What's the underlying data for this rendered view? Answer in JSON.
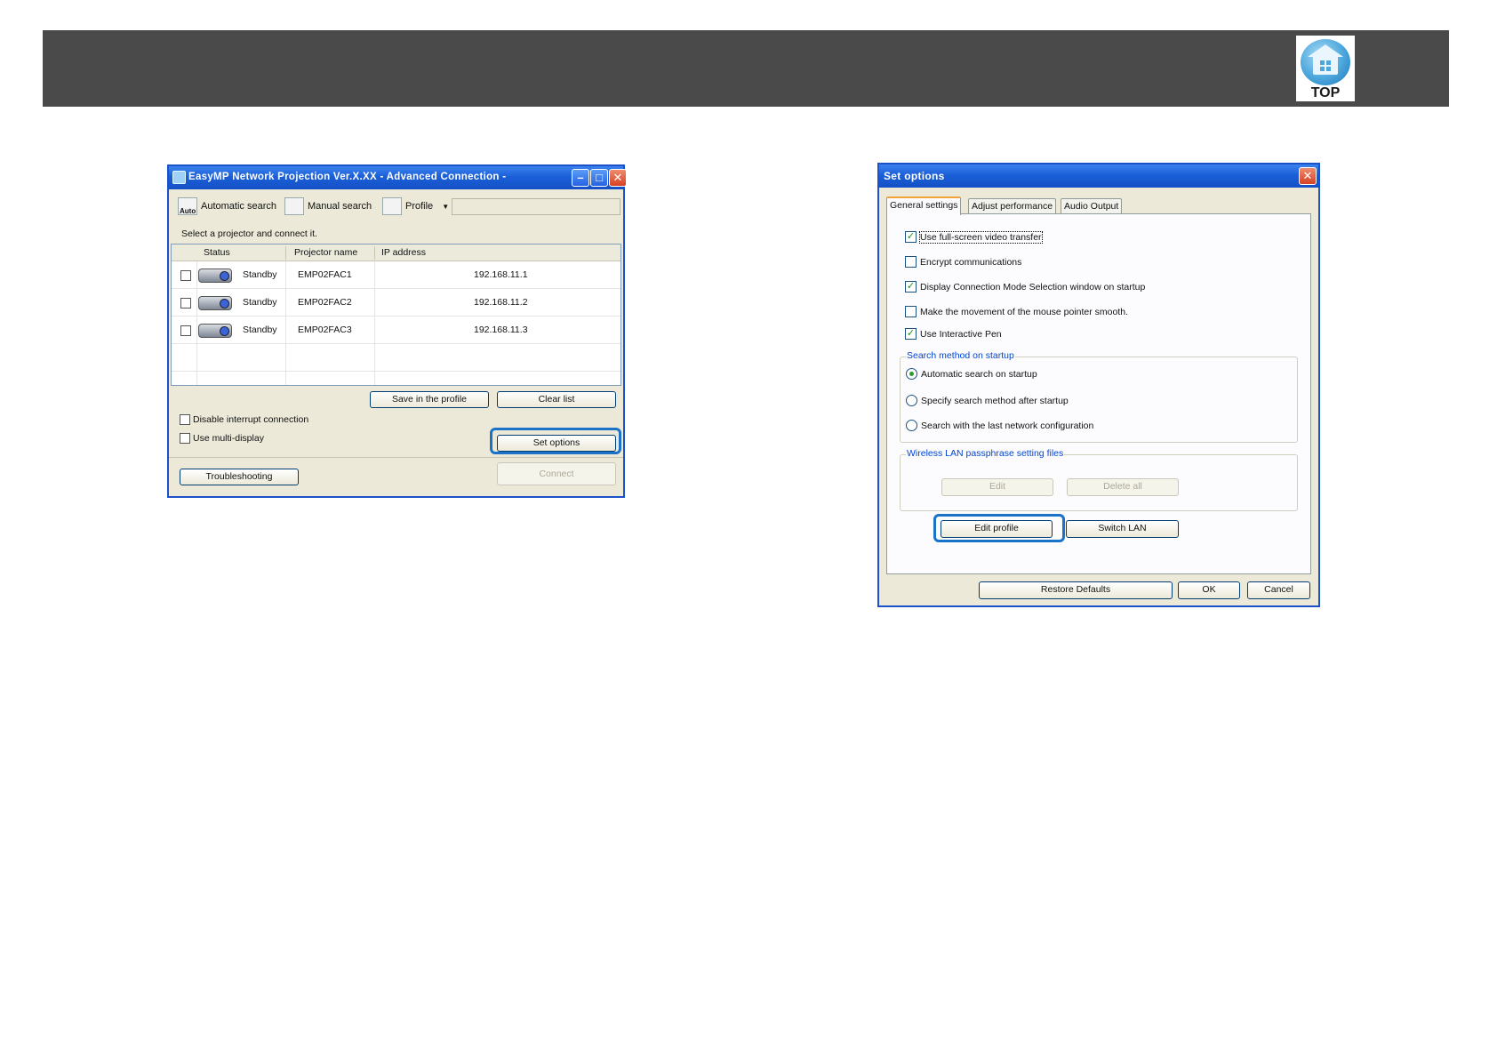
{
  "header": {
    "top_label": "TOP"
  },
  "advanced_window": {
    "title": "EasyMP Network Projection Ver.X.XX - Advanced Connection -",
    "toolbar": {
      "automatic_search": "Automatic search",
      "auto_icon_text": "Auto",
      "manual_search": "Manual search",
      "profile": "Profile"
    },
    "hint": "Select a projector and connect it.",
    "columns": [
      "Status",
      "Projector name",
      "IP address"
    ],
    "rows": [
      {
        "status": "Standby",
        "name": "EMP02FAC1",
        "ip": "192.168.11.1"
      },
      {
        "status": "Standby",
        "name": "EMP02FAC2",
        "ip": "192.168.11.2"
      },
      {
        "status": "Standby",
        "name": "EMP02FAC3",
        "ip": "192.168.11.3"
      }
    ],
    "buttons": {
      "save_profile": "Save in the profile",
      "clear_list": "Clear list",
      "set_options": "Set options",
      "connect": "Connect",
      "troubleshooting": "Troubleshooting"
    },
    "checkboxes": {
      "disable_interrupt": "Disable interrupt connection",
      "multi_display": "Use multi-display"
    }
  },
  "options_window": {
    "title": "Set options",
    "tabs": [
      "General settings",
      "Adjust performance",
      "Audio Output"
    ],
    "options": {
      "full_screen": {
        "label": "Use full-screen video transfer",
        "checked": true
      },
      "encrypt": {
        "label": "Encrypt communications",
        "checked": false
      },
      "display_mode_selection": {
        "label": "Display Connection Mode Selection window on startup",
        "checked": true
      },
      "smooth_pointer": {
        "label": "Make the movement of the mouse pointer smooth.",
        "checked": false
      },
      "interactive_pen": {
        "label": "Use Interactive Pen",
        "checked": true
      }
    },
    "search_group": {
      "label": "Search method on startup",
      "radios": [
        "Automatic search on startup",
        "Specify search method after startup",
        "Search with the last network configuration"
      ],
      "selected": 0
    },
    "wlan_group": {
      "label": "Wireless LAN passphrase setting files",
      "edit": "Edit",
      "delete_all": "Delete all"
    },
    "buttons": {
      "edit_profile": "Edit profile",
      "switch_lan": "Switch LAN",
      "restore_defaults": "Restore Defaults",
      "ok": "OK",
      "cancel": "Cancel"
    }
  },
  "colors": {
    "header_bar": "#4a4a4a",
    "highlight": "#1a73c9",
    "xp_blue": "#1c52c9",
    "group_label": "#0046d5"
  }
}
